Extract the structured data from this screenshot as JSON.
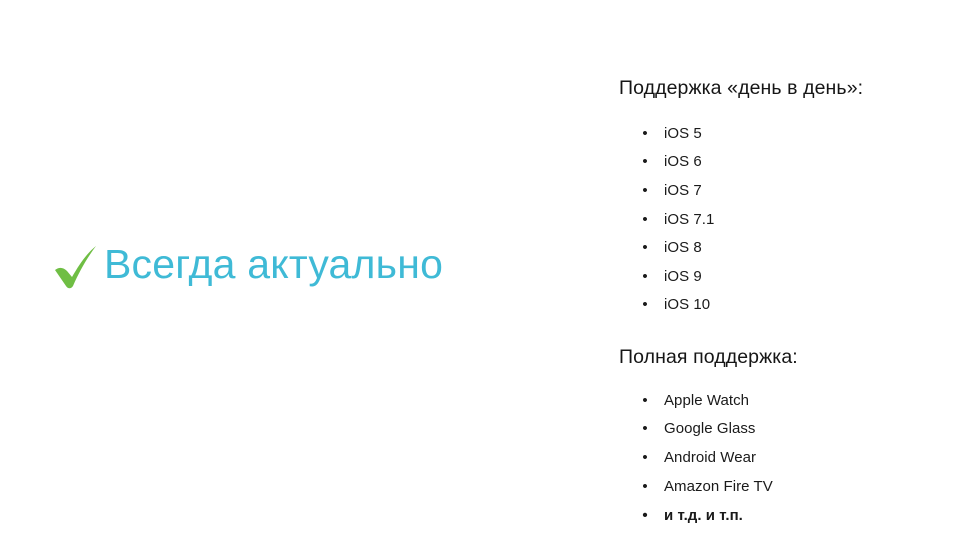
{
  "slide": {
    "headline": {
      "icon": "check-mark-icon",
      "text": "Всегда актуально",
      "color": "#3FBAD6",
      "icon_color": "#6FBE44"
    },
    "sections": [
      {
        "heading": "Поддержка «день в день»:",
        "items": [
          "iOS 5",
          "iOS 6",
          "iOS 7",
          "iOS 7.1",
          "iOS 8",
          "iOS 9",
          "iOS 10"
        ]
      },
      {
        "heading": "Полная поддержка:",
        "items": [
          "Apple Watch",
          "Google Glass",
          "Android Wear",
          "Amazon Fire TV",
          "и т.д. и т.п."
        ]
      }
    ],
    "bullet_glyph": "•",
    "background_color": "#FFFFFF",
    "text_color": "#1A1A1A"
  }
}
